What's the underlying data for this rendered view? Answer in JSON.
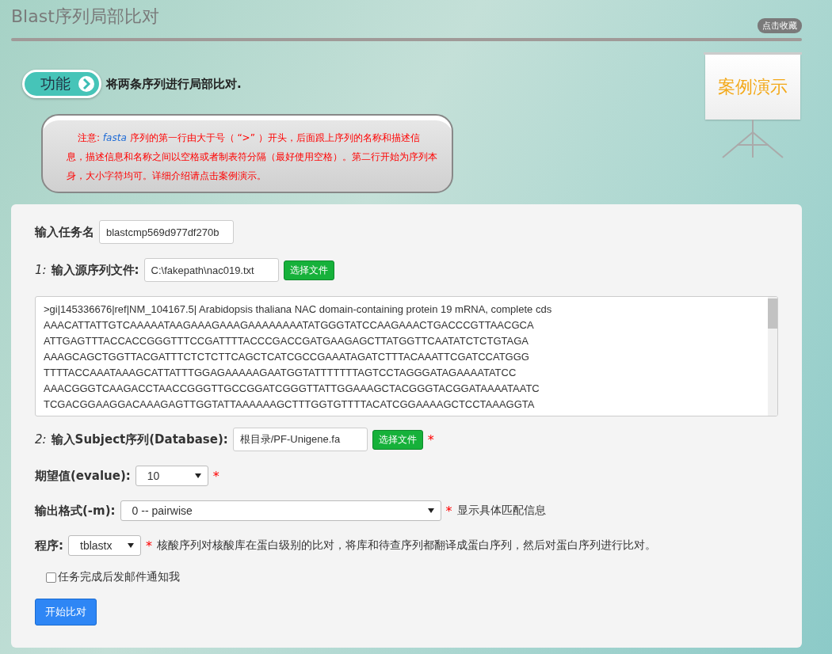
{
  "header": {
    "title": "Blast序列局部比对",
    "bookmark_button": "点击收藏"
  },
  "function": {
    "badge": "功能",
    "description": "将两条序列进行局部比对."
  },
  "demo": {
    "label": "案例演示"
  },
  "note": {
    "prefix": "注意:",
    "keyword": "fasta",
    "text": "序列的第一行由大于号（ “>” ）开头，后面跟上序列的名称和描述信息，描述信息和名称之间以空格或者制表符分隔（最好使用空格）。第二行开始为序列本身，大小字符均可。详细介绍请点击案例演示。"
  },
  "form": {
    "task_name": {
      "label": "输入任务名",
      "value": "blastcmp569d977df270b"
    },
    "source_file": {
      "number": "1:",
      "label": "输入源序列文件:",
      "value": "C:\\fakepath\\nac019.txt",
      "button": "选择文件"
    },
    "sequence_lines": [
      ">gi|145336676|ref|NM_104167.5| Arabidopsis thaliana NAC domain-containing protein 19 mRNA, complete cds",
      "AAACATTATTGTCAAAAATAAGAAAGAAAGAAAAAAAATATGGGTATCCAAGAAACTGACCCGTTAACGCA",
      "ATTGAGTTTACCACCGGGTTTCCGATTTTACCCGACCGATGAAGAGCTTATGGTTCAATATCTCTGTAGA",
      "AAAGCAGCTGGTTACGATTTCTCTCTTCAGCTCATCGCCGAAATAGATCTTTACAAATTCGATCCATGGG",
      "TTTTACCAAATAAAGCATTATTTGGAGAAAAAGAATGGTATTTTTTTAGTCCTAGGGATAGAAAATATCC",
      "AAACGGGTCAAGACCTAACCGGGTTGCCGGATCGGGTTATTGGAAAGCTACGGGTACGGATAAAATAATC",
      "TCGACGGAAGGACAAAGAGTTGGTATTAAAAAAGCTTTGGTGTTTTACATCGGAAAAGCTCCTAAAGGTA"
    ],
    "subject": {
      "number": "2:",
      "label": "输入Subject序列(Database):",
      "value": "根目录/PF-Unigene.fa",
      "button": "选择文件",
      "required": "*"
    },
    "evalue": {
      "label": "期望值(evalue):",
      "value": "10",
      "required": "*"
    },
    "output_format": {
      "label": "输出格式(-m):",
      "value": "0 -- pairwise",
      "required": "*",
      "hint": "显示具体匹配信息"
    },
    "program": {
      "label": "程序:",
      "value": "tblastx",
      "required": "*",
      "hint": "核酸序列对核酸库在蛋白级别的比对，将库和待查序列都翻译成蛋白序列，然后对蛋白序列进行比对。"
    },
    "email_notify": {
      "label": "任务完成后发邮件通知我",
      "checked": false
    },
    "submit_button": "开始比对"
  }
}
